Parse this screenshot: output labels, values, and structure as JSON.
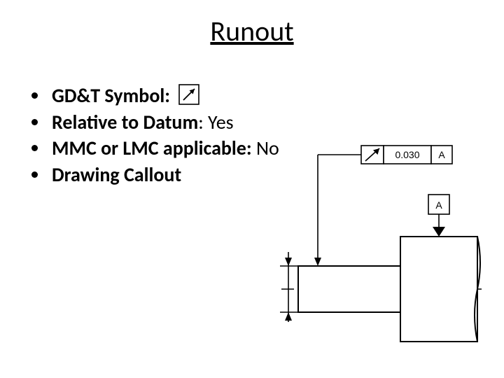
{
  "title": "Runout",
  "bullets": {
    "b1_label": "GD&T Symbol:",
    "b2_label": "Relative to Datum",
    "b2_value": ": Yes",
    "b3_label": "MMC or LMC applicable: ",
    "b3_value": "No",
    "b4_label": "Drawing Callout"
  },
  "callout": {
    "tolerance": "0.030",
    "datum": "A",
    "datum_label": "A"
  }
}
